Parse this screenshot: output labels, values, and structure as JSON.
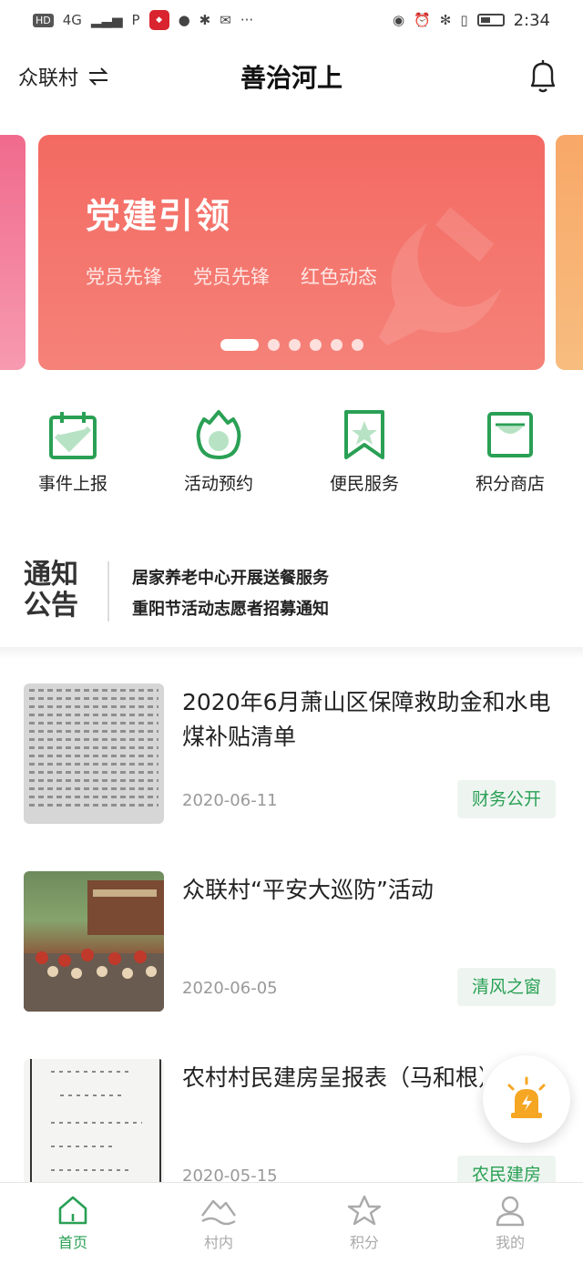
{
  "status_bar": {
    "left_badges": [
      "HD",
      "4G",
      "P"
    ],
    "time": "2:34"
  },
  "header": {
    "village": "众联村",
    "title": "善治河上"
  },
  "banner": {
    "title": "党建引领",
    "tags": [
      "党员先锋",
      "党员先锋",
      "红色动态"
    ],
    "page_count": 6,
    "active_index": 0,
    "colors": {
      "main": "#f36a62",
      "left_peek": "#f06a8c",
      "right_peek": "#f8a868"
    }
  },
  "quick_actions": [
    {
      "label": "事件上报",
      "icon": "calendar-check-icon"
    },
    {
      "label": "活动预约",
      "icon": "flame-icon"
    },
    {
      "label": "便民服务",
      "icon": "bookmark-star-icon"
    },
    {
      "label": "积分商店",
      "icon": "shop-bag-icon"
    }
  ],
  "notice": {
    "logo_line1": "通知",
    "logo_line2": "公告",
    "items": [
      "居家养老中心开展送餐服务",
      "重阳节活动志愿者招募通知"
    ]
  },
  "news": [
    {
      "title": "2020年6月萧山区保障救助金和水电煤补贴清单",
      "date": "2020-06-11",
      "tag": "财务公开"
    },
    {
      "title": "众联村“平安大巡防”活动",
      "date": "2020-06-05",
      "tag": "清风之窗"
    },
    {
      "title": "农村村民建房呈报表（马和根）",
      "date": "2020-05-15",
      "tag": "农民建房"
    }
  ],
  "tabbar": [
    {
      "label": "首页",
      "icon": "home-icon",
      "active": true
    },
    {
      "label": "村内",
      "icon": "mountain-icon",
      "active": false
    },
    {
      "label": "积分",
      "icon": "star-icon",
      "active": false
    },
    {
      "label": "我的",
      "icon": "user-icon",
      "active": false
    }
  ],
  "accent_color": "#2aa055"
}
